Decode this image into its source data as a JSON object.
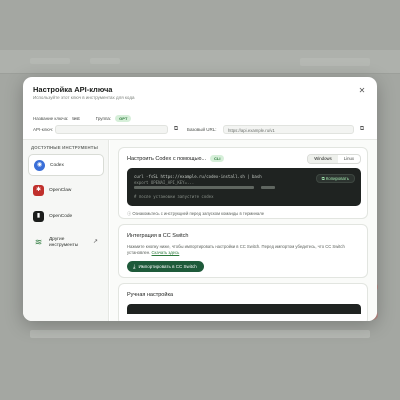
{
  "modal": {
    "title": "Настройка API-ключа",
    "subtitle": "Используйте этот ключ в инструментах для кода",
    "close_icon": "close-icon"
  },
  "key_info": {
    "name_label": "Название ключа:",
    "name_value": "test",
    "group_label": "Группа:",
    "group_value": "GPT"
  },
  "fields": {
    "api_key_label": "API-ключ:",
    "api_key_value": "",
    "base_url_label": "Базовый URL:",
    "base_url_value": "https://api.example.ru/v1"
  },
  "sidebar": {
    "title": "ДОСТУПНЫЕ ИНСТРУМЕНТЫ",
    "items": [
      {
        "label": "Codex",
        "icon": "codex-icon",
        "color": "#3a6fd8",
        "active": true
      },
      {
        "label": "OpenClaw",
        "icon": "openclaw-icon",
        "color": "#c0302c",
        "active": false
      },
      {
        "label": "OpenCode",
        "icon": "opencode-icon",
        "color": "#1b1d1b",
        "active": false
      },
      {
        "label": "Другие инструменты",
        "icon": "other-tools-icon",
        "color": "#2c7a3c",
        "active": false
      }
    ]
  },
  "card1": {
    "title": "Настроить Codex с помощью...",
    "badge": "CLI",
    "seg_options": [
      "Windows",
      "Linux"
    ],
    "code_lines": [
      "curl -fsSL https://example.ru/codex-install.sh | bash",
      "export OPENAI_API_KEY=...",
      "# после установки запустите codex"
    ],
    "copy_button": "Копировать",
    "note": "Ознакомьтесь с инструкцией перед запуском команды в терминале"
  },
  "card2": {
    "title": "Интеграция в CC Switch",
    "text": "Нажмите кнопку ниже, чтобы импортировать настройки в CC Switch. Перед импортом убедитесь, что CC Switch установлен.",
    "link": "Скачать здесь",
    "button": "Импортировать в CC Switch",
    "button_icon": "download-icon"
  },
  "card3": {
    "title": "Ручная настройка"
  }
}
